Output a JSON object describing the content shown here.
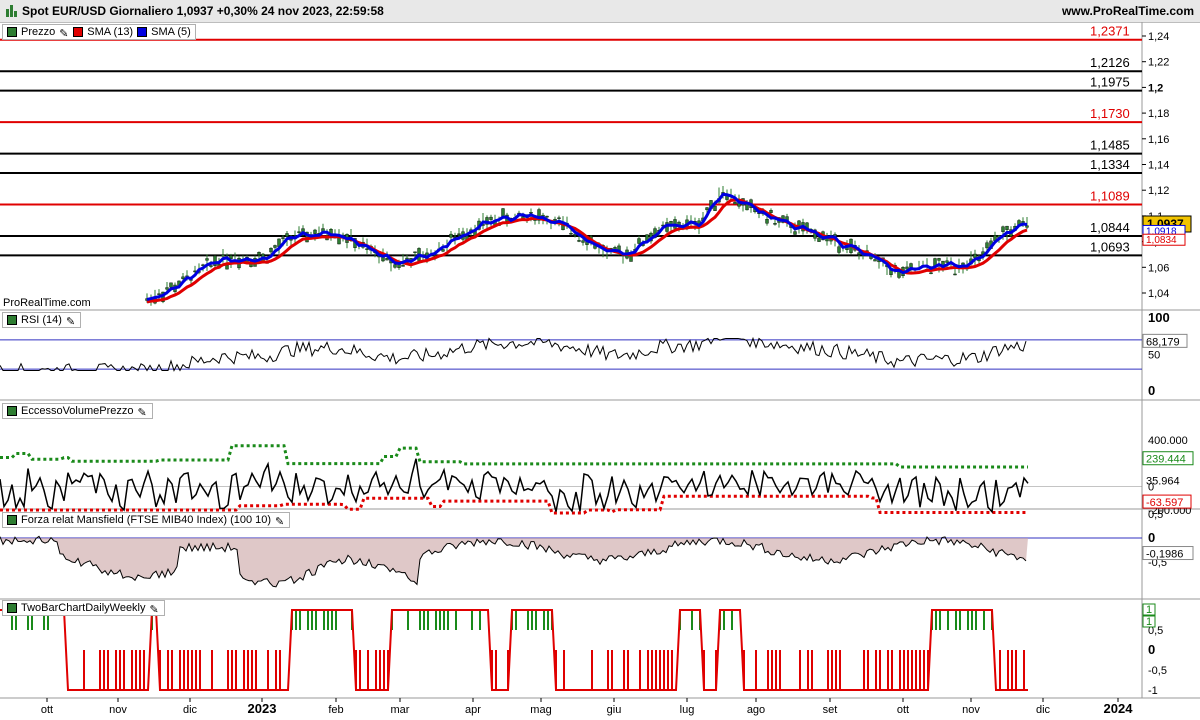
{
  "header": {
    "title": "Spot EUR/USD Giornaliero 1,0937 +0,30% 24 nov 2023, 22:59:58",
    "site": "www.ProRealTime.com"
  },
  "watermark": "ProRealTime.com",
  "panels": {
    "price": {
      "legend": [
        {
          "label": "Prezzo",
          "color": "#2e7d32"
        },
        {
          "label": "SMA (13)",
          "color": "#e00000"
        },
        {
          "label": "SMA (5)",
          "color": "#0000e0"
        }
      ],
      "ticks": [
        "1,24",
        "1,22",
        "1,2",
        "1,18",
        "1,16",
        "1,14",
        "1,12",
        "1,1",
        "1,08",
        "1,06",
        "1,04"
      ],
      "level_labels": [
        {
          "text": "1,2371",
          "color": "#e00000"
        },
        {
          "text": "1,2126",
          "color": "#000000"
        },
        {
          "text": "1,1975",
          "color": "#000000"
        },
        {
          "text": "1,1730",
          "color": "#e00000"
        },
        {
          "text": "1,1485",
          "color": "#000000"
        },
        {
          "text": "1,1334",
          "color": "#000000"
        },
        {
          "text": "1,1089",
          "color": "#e00000"
        },
        {
          "text": "1,0844",
          "color": "#000000"
        },
        {
          "text": "1,0693",
          "color": "#000000"
        }
      ],
      "last_price": "1,0937",
      "sma5_label": "1,0918",
      "sma13_label": "1,0834"
    },
    "rsi": {
      "legend": "RSI (14)",
      "ticks": [
        "100",
        "50",
        "0"
      ],
      "value": "68,179"
    },
    "volume": {
      "legend": "EccessoVolumePrezzo",
      "ticks": [
        "400.000",
        "0",
        "-200.000"
      ],
      "upper": "239.444",
      "value": "35.964",
      "lower": "-63.597"
    },
    "mansfield": {
      "legend": "Forza relat Mansfield (FTSE MIB40 Index) (100 10)",
      "ticks": [
        "0,5",
        "0",
        "-0,5"
      ],
      "value": "-0,1986"
    },
    "twobar": {
      "legend": "TwoBarChartDailyWeekly",
      "ticks": [
        "0,5",
        "0",
        "-0,5",
        "-1"
      ],
      "value_a": "1",
      "value_b": "1"
    }
  },
  "x_axis": [
    "ott",
    "nov",
    "dic",
    "2023",
    "feb",
    "mar",
    "apr",
    "mag",
    "giu",
    "lug",
    "ago",
    "set",
    "ott",
    "nov",
    "dic",
    "2024"
  ],
  "colors": {
    "up": "#2e7d32",
    "sma13": "#e00000",
    "sma5": "#0000e0",
    "grid": "#000000"
  },
  "chart_data": {
    "type": "line",
    "title": "Spot EUR/USD Giornaliero",
    "series": [
      {
        "name": "Prezzo",
        "kind": "close",
        "x": [
          "nov",
          "dic",
          "2023",
          "feb",
          "mar",
          "apr",
          "mag",
          "giu",
          "lug",
          "ago",
          "set",
          "ott",
          "nov"
        ],
        "values": [
          1.04,
          1.06,
          1.07,
          1.09,
          1.06,
          1.08,
          1.1,
          1.07,
          1.11,
          1.1,
          1.08,
          1.05,
          1.09
        ]
      },
      {
        "name": "SMA (13)",
        "values": [
          1.035,
          1.055,
          1.065,
          1.085,
          1.065,
          1.075,
          1.095,
          1.075,
          1.105,
          1.105,
          1.085,
          1.055,
          1.083
        ]
      },
      {
        "name": "SMA (5)",
        "values": [
          1.04,
          1.06,
          1.07,
          1.09,
          1.06,
          1.08,
          1.1,
          1.07,
          1.12,
          1.1,
          1.08,
          1.05,
          1.092
        ]
      }
    ],
    "ylim": [
      1.03,
      1.25
    ]
  }
}
